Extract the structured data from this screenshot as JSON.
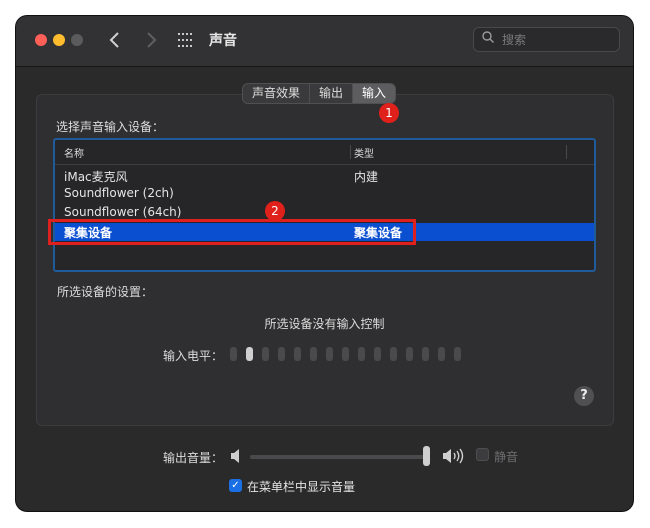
{
  "window": {
    "title": "声音"
  },
  "search": {
    "placeholder": "搜索",
    "value": ""
  },
  "tabs": [
    {
      "label": "声音效果",
      "active": false
    },
    {
      "label": "输出",
      "active": false
    },
    {
      "label": "输入",
      "active": true
    }
  ],
  "annotations": {
    "badge1": "1",
    "badge2": "2"
  },
  "input_section": {
    "heading": "选择声音输入设备："
  },
  "device_table": {
    "columns": [
      "名称",
      "类型"
    ],
    "rows": [
      {
        "name": "iMac麦克风",
        "type": "内建",
        "selected": false
      },
      {
        "name": "Soundflower (2ch)",
        "type": "",
        "selected": false
      },
      {
        "name": "Soundflower (64ch)",
        "type": "",
        "selected": false
      },
      {
        "name": "聚集设备",
        "type": "聚集设备",
        "selected": true
      }
    ]
  },
  "selected_settings": {
    "heading": "所选设备的设置：",
    "message": "所选设备没有输入控制",
    "level_label": "输入电平：",
    "level_segments_total": 15,
    "level_segments_lit": 1
  },
  "help": {
    "label": "?"
  },
  "output": {
    "volume_label": "输出音量：",
    "volume_fraction": 0.98,
    "mute_label": "静音",
    "mute_checked": false,
    "show_in_menubar_label": "在菜单栏中显示音量",
    "show_in_menubar_checked": true
  },
  "colors": {
    "window_bg": "#2a2a2b",
    "selected_row": "#0b4fd1",
    "table_border": "#1f5a9b",
    "annotation_red": "#e01f1f",
    "checkbox_blue": "#1a6fe5"
  }
}
